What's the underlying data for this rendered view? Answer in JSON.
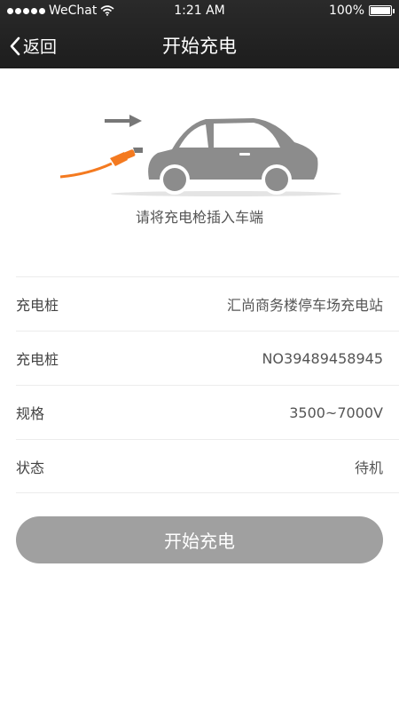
{
  "status_bar": {
    "carrier": "WeChat",
    "time": "1:21 AM",
    "battery": "100%"
  },
  "navbar": {
    "back_label": "返回",
    "title": "开始充电"
  },
  "hint": "请将充电枪插入车端",
  "info_rows": [
    {
      "label": "充电桩",
      "value": "汇尚商务楼停车场充电站"
    },
    {
      "label": "充电桩",
      "value": "NO39489458945"
    },
    {
      "label": "规格",
      "value": "3500~7000V"
    },
    {
      "label": "状态",
      "value": "待机"
    }
  ],
  "start_button": "开始充电",
  "colors": {
    "nav_bg": "#1d1d1d",
    "accent": "#f47a20",
    "button_bg": "#a0a0a0",
    "car": "#8c8c8c"
  },
  "icons": [
    "signal-dots-icon",
    "wifi-icon",
    "battery-icon",
    "chevron-left-icon",
    "car-illustration",
    "charging-plug-icon",
    "arrow-right-icon"
  ]
}
